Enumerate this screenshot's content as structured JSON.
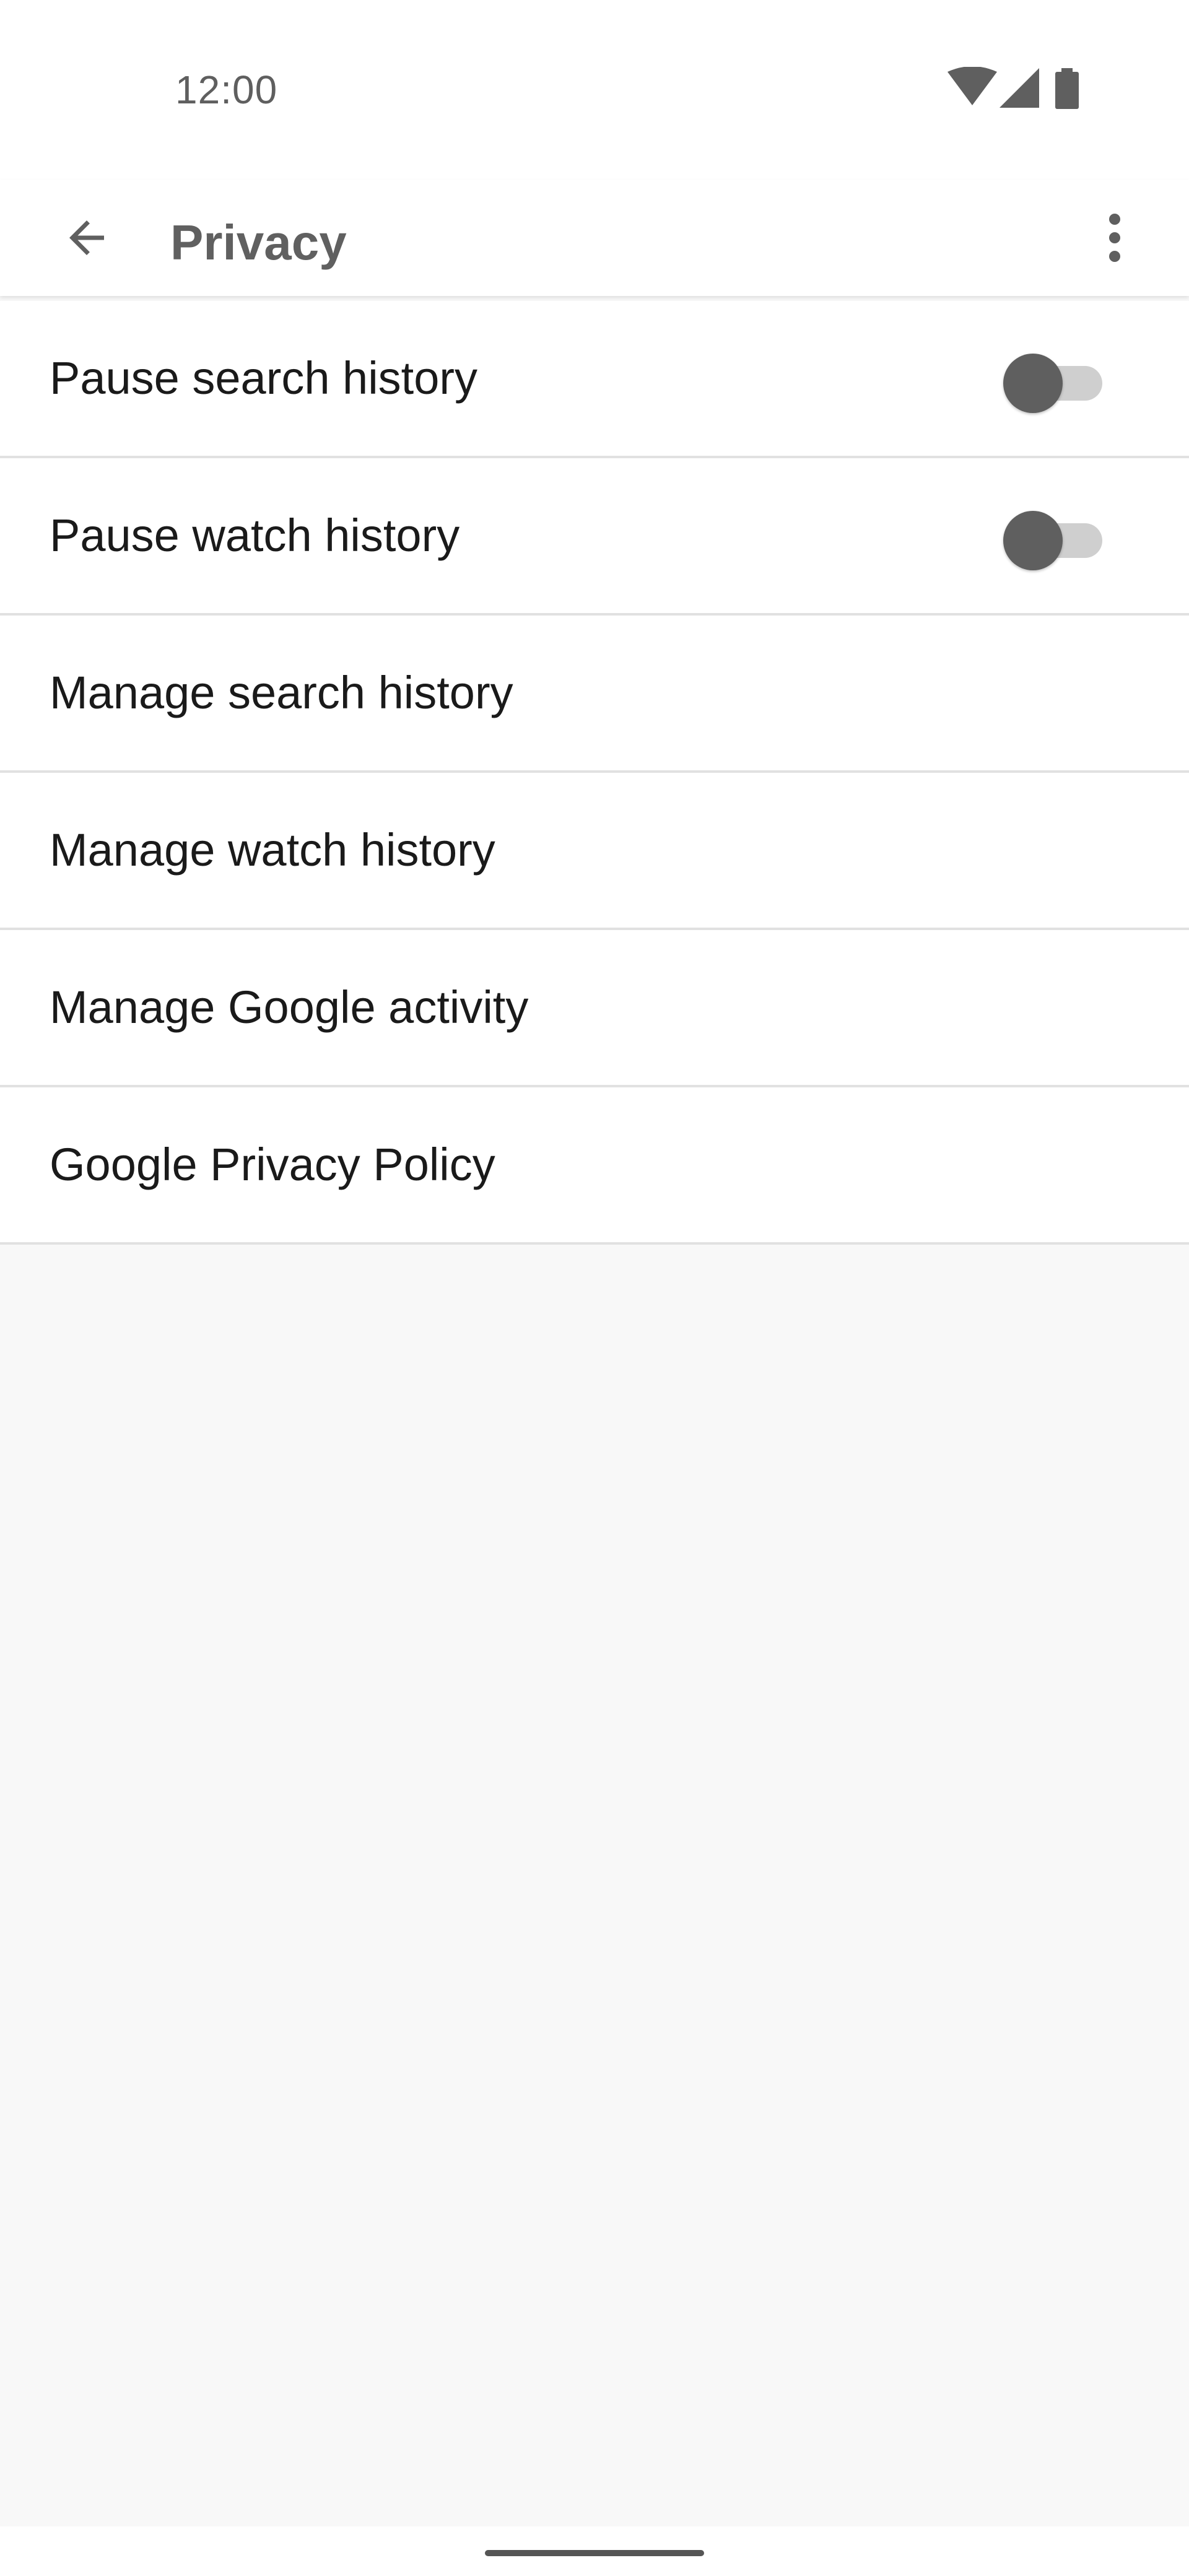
{
  "status_bar": {
    "time": "12:00",
    "icons": [
      "wifi-icon",
      "cell-signal-icon",
      "battery-icon"
    ]
  },
  "app_bar": {
    "title": "Privacy",
    "back_icon": "arrow-back-icon",
    "more_icon": "more-vert-icon"
  },
  "settings": {
    "items": [
      {
        "label": "Pause search history",
        "type": "toggle",
        "checked": false
      },
      {
        "label": "Pause watch history",
        "type": "toggle",
        "checked": false
      },
      {
        "label": "Manage search history",
        "type": "link"
      },
      {
        "label": "Manage watch history",
        "type": "link"
      },
      {
        "label": "Manage Google activity",
        "type": "link"
      },
      {
        "label": "Google Privacy Policy",
        "type": "link"
      }
    ]
  },
  "colors": {
    "title_text": "#606060",
    "item_text": "#1a1a1a",
    "toggle_thumb_off": "#5f5f5f",
    "toggle_track_off": "#cfcfcf",
    "page_background": "#f8f8f8",
    "divider": "#e1e1e1"
  }
}
